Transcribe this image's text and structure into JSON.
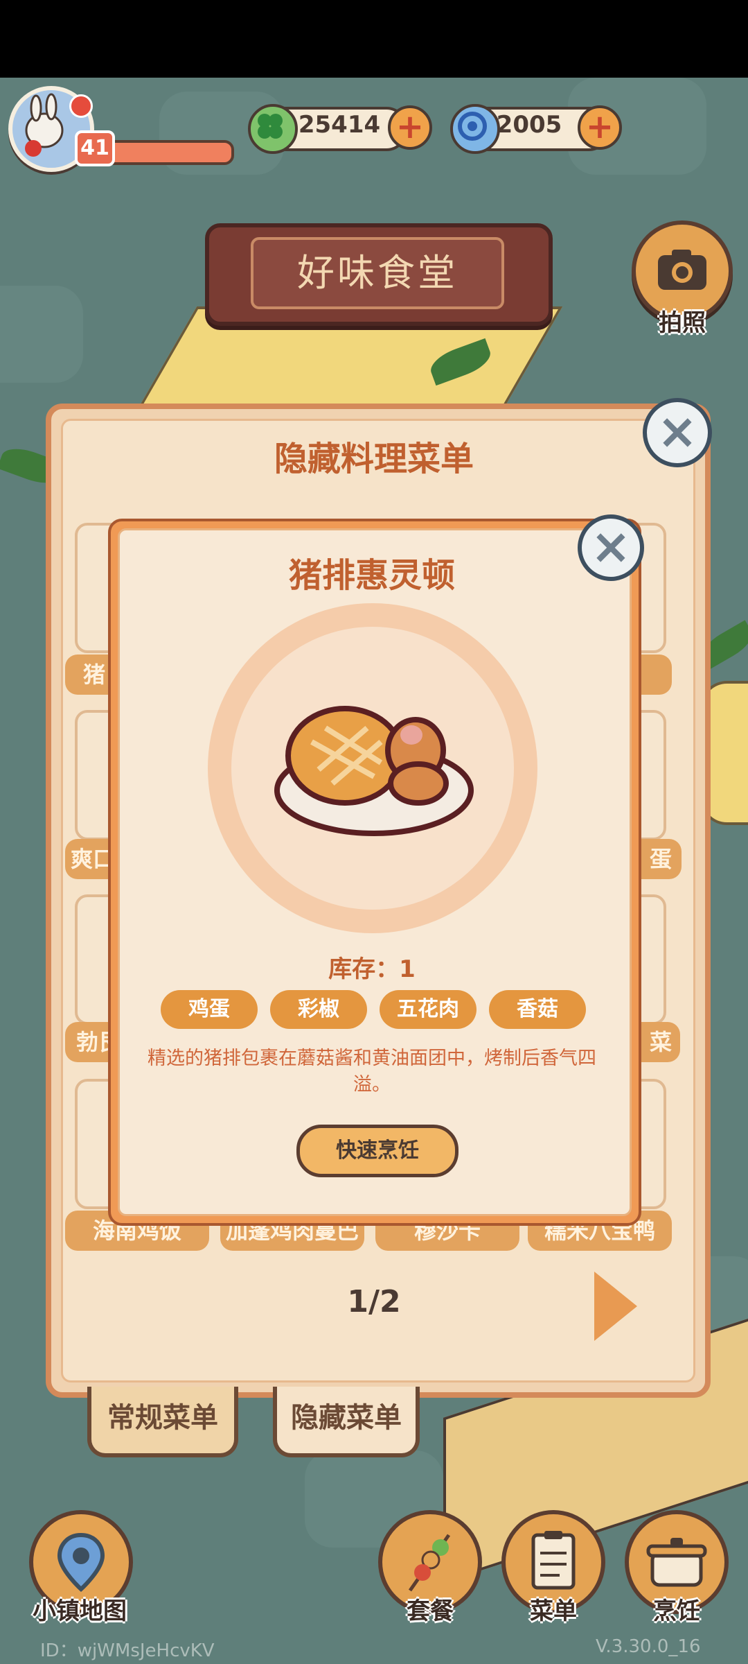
{
  "hud": {
    "level": "41",
    "clover_coins": "25414",
    "spiral_gems": "2005",
    "plus_symbol": "+"
  },
  "restaurant_sign": "好味食堂",
  "photo_button_label": "拍照",
  "recipe_panel": {
    "title": "隐藏料理菜单",
    "close_symbol": "×",
    "dish_names": [
      "猪",
      "",
      "爽口",
      "蛋",
      "勃艮",
      "菜",
      "海南鸡饭",
      "加蓬鸡肉蔓巴",
      "穆沙卡",
      "糯米八宝鸭"
    ],
    "page_indicator": "1/2",
    "tabs": [
      "常规菜单",
      "隐藏菜单"
    ]
  },
  "dish_modal": {
    "title": "猪排惠灵顿",
    "close_symbol": "×",
    "stock_label": "库存：1",
    "ingredients": [
      "鸡蛋",
      "彩椒",
      "五花肉",
      "香菇"
    ],
    "description": "精选的猪排包裹在蘑菇酱和黄油面团中，烤制后香气四溢。",
    "cook_button": "快速烹饪"
  },
  "bottom_nav": {
    "map": "小镇地图",
    "combo": "套餐",
    "menu": "菜单",
    "cook": "烹饪"
  },
  "footer": {
    "id_text": "ID：wjWMsJeHcvKV",
    "version": "V.3.30.0_16"
  },
  "colors": {
    "accent_orange": "#e4963f",
    "title_orange": "#c0602f",
    "panel_border": "#d48a5a"
  }
}
